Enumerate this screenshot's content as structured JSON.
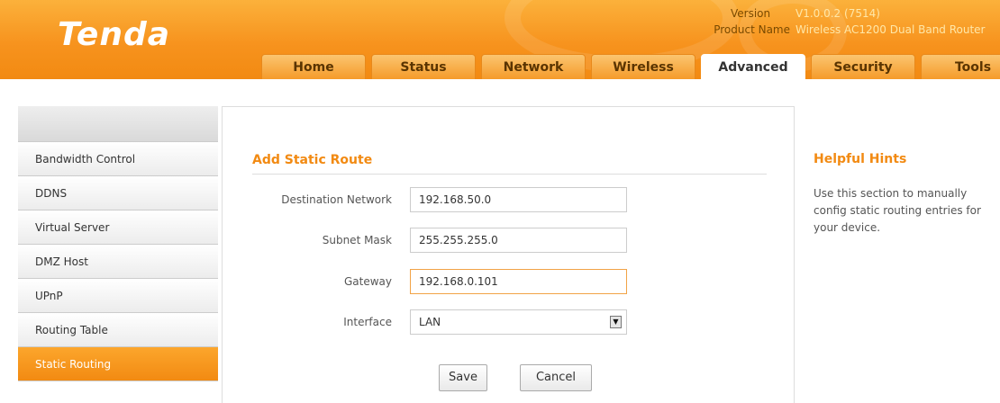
{
  "brand": {
    "logo_text": "Tenda",
    "accent": "#f28a12"
  },
  "header_info": {
    "version_label": "Version",
    "version_value": "V1.0.0.2 (7514)",
    "product_label": "Product Name",
    "product_value": "Wireless AC1200 Dual Band Router"
  },
  "tabs": [
    {
      "label": "Home",
      "active": false
    },
    {
      "label": "Status",
      "active": false
    },
    {
      "label": "Network",
      "active": false
    },
    {
      "label": "Wireless",
      "active": false
    },
    {
      "label": "Advanced",
      "active": true
    },
    {
      "label": "Security",
      "active": false
    },
    {
      "label": "Tools",
      "active": false
    }
  ],
  "sidebar": {
    "items": [
      {
        "label": "Bandwidth Control"
      },
      {
        "label": "DDNS"
      },
      {
        "label": "Virtual Server"
      },
      {
        "label": "DMZ Host"
      },
      {
        "label": "UPnP"
      },
      {
        "label": "Routing Table"
      },
      {
        "label": "Static Routing",
        "active": true
      }
    ]
  },
  "form": {
    "title": "Add Static Route",
    "destination_label": "Destination Network",
    "destination_value": "192.168.50.0",
    "mask_label": "Subnet Mask",
    "mask_value": "255.255.255.0",
    "gateway_label": "Gateway",
    "gateway_value": "192.168.0.101",
    "interface_label": "Interface",
    "interface_value": "LAN",
    "save_label": "Save",
    "cancel_label": "Cancel"
  },
  "hints": {
    "title": "Helpful Hints",
    "text": "Use this section to manually config static routing entries for your device."
  }
}
